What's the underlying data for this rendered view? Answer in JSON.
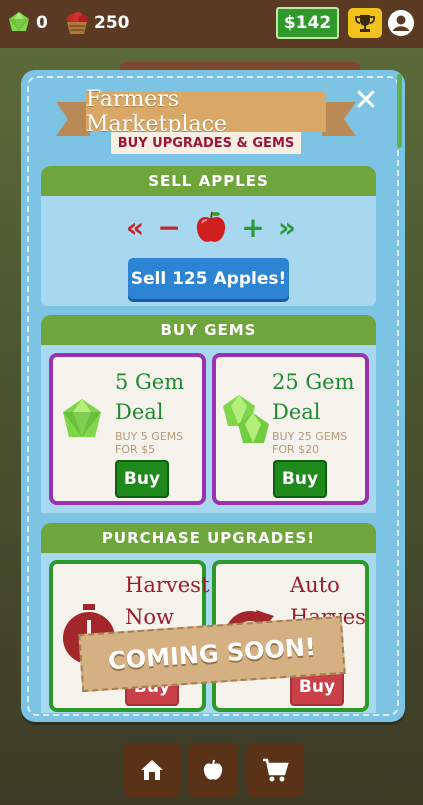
{
  "topbar": {
    "gems": "0",
    "apples": "250",
    "money": "$142"
  },
  "modal": {
    "title": "Farmers Marketplace",
    "subtitle": "BUY UPGRADES & GEMS",
    "close_label": "✕"
  },
  "sell": {
    "header": "SELL APPLES",
    "decrease_fast": "«",
    "decrease": "−",
    "increase": "+",
    "increase_fast": "»",
    "button_label": "Sell 125 Apples!"
  },
  "gems": {
    "header": "BUY GEMS",
    "deals": [
      {
        "title_line1": "5 Gem",
        "title_line2": "Deal",
        "desc_line1": "BUY 5 GEMS",
        "desc_line2": "FOR $5",
        "button": "Buy"
      },
      {
        "title_line1": "25 Gem",
        "title_line2": "Deal",
        "desc_line1": "BUY 25 GEMS",
        "desc_line2": "FOR $20",
        "button": "Buy"
      }
    ]
  },
  "upgrades": {
    "header": "PURCHASE UPGRADES!",
    "items": [
      {
        "title_line1": "Harvest",
        "title_line2": "Now",
        "button": "Buy"
      },
      {
        "title_line1": "Auto",
        "title_line2": "Harvest",
        "button": "Buy"
      }
    ],
    "overlay": "COMING SOON!"
  },
  "colors": {
    "modal_bg": "#7cc3e4",
    "section_header": "#6fa63c",
    "buy_green": "#1f8a1c",
    "gem_card_border": "#9a31b1",
    "upgrade_card_border": "#2b9a2b"
  },
  "icons": [
    "gem-icon",
    "apple-basket-icon",
    "trophy-icon",
    "profile-icon",
    "close-icon",
    "apple-icon",
    "stopwatch-icon",
    "refresh-icon",
    "home-icon",
    "cart-icon"
  ]
}
